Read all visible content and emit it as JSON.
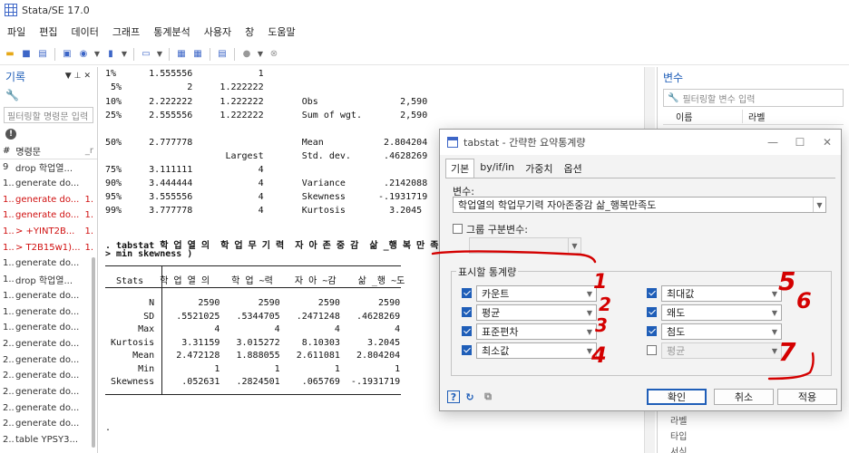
{
  "window": {
    "title": "Stata/SE 17.0"
  },
  "menu": [
    "파일",
    "편집",
    "데이터",
    "그래프",
    "통계분석",
    "사용자",
    "창",
    "도움말"
  ],
  "history": {
    "title": "기록",
    "filter_placeholder": "필터링할 명령문 입력",
    "col_num": "#",
    "col_command": "명령문",
    "col_rc": "_r",
    "items": [
      {
        "num": "9",
        "text": "drop 학업열...",
        "rc": "",
        "error": false
      },
      {
        "num": "1..",
        "text": "generate do...",
        "rc": "",
        "error": false
      },
      {
        "num": "1..",
        "text": "generate do...",
        "rc": "1.",
        "error": true
      },
      {
        "num": "1..",
        "text": "generate do...",
        "rc": "1.",
        "error": true
      },
      {
        "num": "1..",
        "text": "> +YINT2B...",
        "rc": "1.",
        "error": true
      },
      {
        "num": "1..",
        "text": "> T2B15w1)...",
        "rc": "1.",
        "error": true
      },
      {
        "num": "1..",
        "text": "generate do...",
        "rc": "",
        "error": false
      },
      {
        "num": "1..",
        "text": "drop 학업열...",
        "rc": "",
        "error": false
      },
      {
        "num": "1..",
        "text": "generate do...",
        "rc": "",
        "error": false
      },
      {
        "num": "1..",
        "text": "generate do...",
        "rc": "",
        "error": false
      },
      {
        "num": "1..",
        "text": "generate do...",
        "rc": "",
        "error": false
      },
      {
        "num": "2..",
        "text": "generate do...",
        "rc": "",
        "error": false
      },
      {
        "num": "2..",
        "text": "generate do...",
        "rc": "",
        "error": false
      },
      {
        "num": "2..",
        "text": "generate do...",
        "rc": "",
        "error": false
      },
      {
        "num": "2..",
        "text": "generate do...",
        "rc": "",
        "error": false
      },
      {
        "num": "2..",
        "text": "generate do...",
        "rc": "",
        "error": false
      },
      {
        "num": "2..",
        "text": "generate do...",
        "rc": "",
        "error": false
      },
      {
        "num": "2..",
        "text": "table YPSY3...",
        "rc": "",
        "error": false
      }
    ]
  },
  "results": {
    "pct_rows": [
      "1%      1.555556            1",
      " 5%            2     1.222222",
      "10%     2.222222     1.222222       Obs               2,590",
      "25%     2.555556     1.222222       Sum of wgt.       2,590",
      "50%     2.777778                    Mean           2.804204",
      "                      Largest       Std. dev.      .4628269",
      "75%     3.111111            4",
      "90%     3.444444            4       Variance       .2142088",
      "95%     3.555556            4       Skewness      -.1931719",
      "99%     3.777778            4       Kurtosis        3.2045"
    ],
    "cmd1": ". tabstat 학 업 열 의  학 업 무 기 력  자 아 존 중 감  삶 _행 복 만 족 도 , stat",
    "cmd2": "> min skewness )",
    "table_header": "  Stats   학 업 열 의    학 업 ~력    자 아 ~감    삶 _행 ~도",
    "table_rows": [
      "        N        2590       2590       2590       2590",
      "       SD    .5521025   .5344705   .2471248   .4628269",
      "      Max           4          4          4          4",
      " Kurtosis     3.31159   3.015272    8.10303     3.2045",
      "     Mean    2.472128   1.888055   2.611081   2.804204",
      "      Min           1          1          1          1",
      " Skewness     .052631   .2824501    .065769  -.1931719"
    ],
    "prompt": "."
  },
  "variables": {
    "title": "변수",
    "filter_placeholder": "필터링할 변수 입력",
    "col_name": "이름",
    "col_label": "라벨",
    "props": [
      "라벨",
      "타입",
      "서식"
    ]
  },
  "dialog": {
    "title": "tabstat - 간략한 요약통계량",
    "tabs": [
      "기본",
      "by/if/in",
      "가중치",
      "옵션"
    ],
    "var_label": "변수:",
    "var_value": "학업열의 학업무기력 자아존중감 삶_행복만족도",
    "group_label": "그룹 구분변수:",
    "stats_label": "표시할 통계량",
    "stats": [
      {
        "label": "카운트",
        "checked": true
      },
      {
        "label": "평균",
        "checked": true
      },
      {
        "label": "표준편차",
        "checked": true
      },
      {
        "label": "최소값",
        "checked": true
      },
      {
        "label": "최대값",
        "checked": true
      },
      {
        "label": "왜도",
        "checked": true
      },
      {
        "label": "첨도",
        "checked": true
      },
      {
        "label": "평균",
        "checked": false
      }
    ],
    "buttons": {
      "ok": "확인",
      "cancel": "취소",
      "apply": "적용"
    }
  },
  "annotations": [
    "1",
    "2",
    "3",
    "4",
    "5",
    "6",
    "7"
  ],
  "colors": {
    "accent": "#1f5eb8",
    "error": "#d01010",
    "annotation": "#d40000"
  }
}
